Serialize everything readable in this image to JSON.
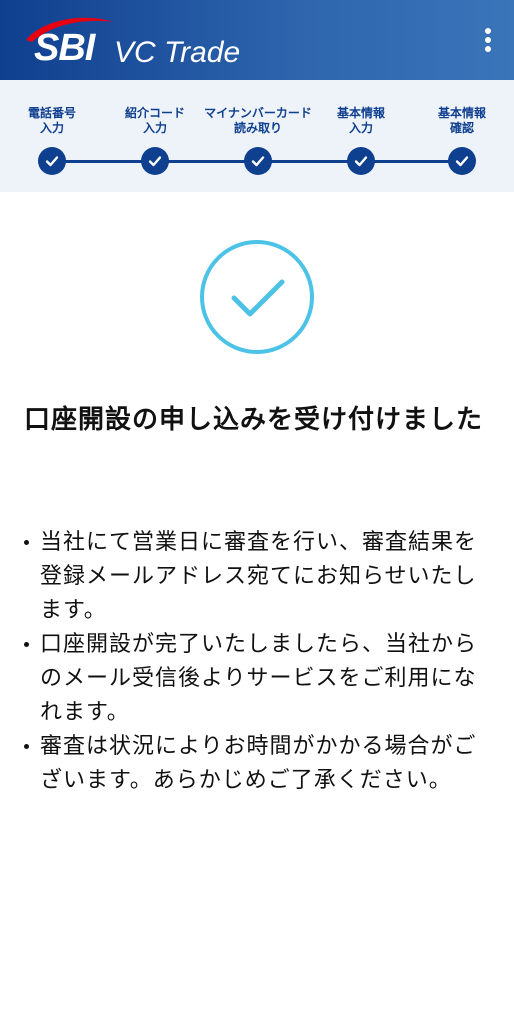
{
  "header": {
    "logo_sbi": "SBI",
    "logo_vc": "VC Trade",
    "menu_icon": "more-vertical-icon",
    "brand_color": "#0f3f8f",
    "swoosh_color": "#e60012"
  },
  "steps": [
    {
      "label": "電話番号\n入力",
      "status": "completed"
    },
    {
      "label": "紹介コード\n入力",
      "status": "completed"
    },
    {
      "label": "マイナンバーカード\n読み取り",
      "status": "completed"
    },
    {
      "label": "基本情報\n入力",
      "status": "completed"
    },
    {
      "label": "基本情報\n確認",
      "status": "completed"
    }
  ],
  "success": {
    "icon": "check-circle-icon",
    "icon_color": "#4cc3e6",
    "title": "口座開設の申し込みを受け付けました"
  },
  "notes": [
    "当社にて営業日に審査を行い、審査結果を登録メールアドレス宛てにお知らせいたします。",
    "口座開設が完了いたしましたら、当社からのメール受信後よりサービスをご利用になれます。",
    "審査は状況によりお時間がかかる場合がございます。あらかじめご了承ください。"
  ]
}
